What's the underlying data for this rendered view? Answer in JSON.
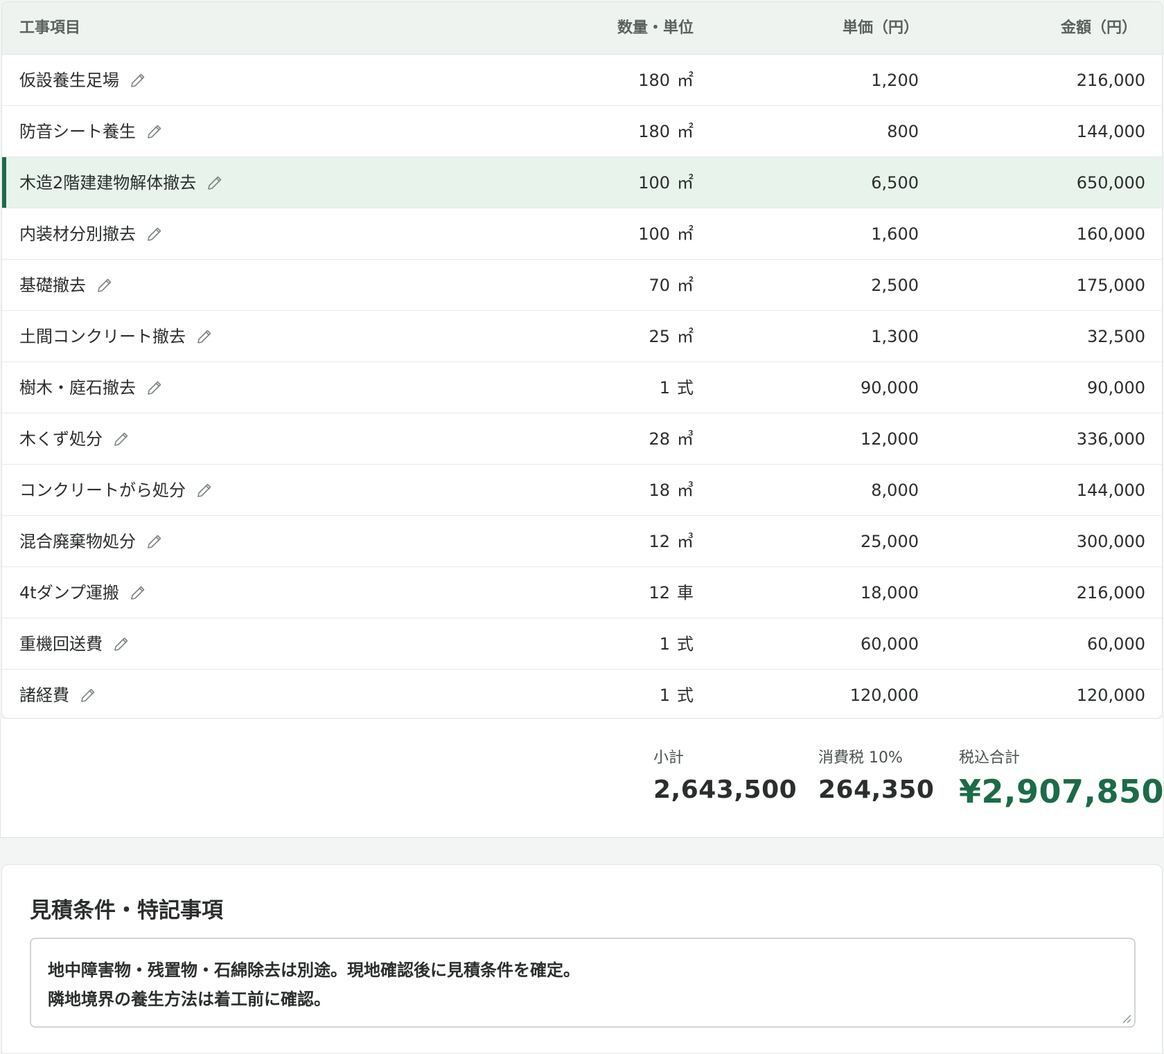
{
  "table": {
    "headers": {
      "item": "工事項目",
      "qty": "数量・単位",
      "unit_price": "単価（円）",
      "amount": "金額（円）"
    },
    "rows": [
      {
        "name": "仮設養生足場",
        "qty": "180",
        "unit": "㎡",
        "price": "1,200",
        "amount": "216,000"
      },
      {
        "name": "防音シート養生",
        "qty": "180",
        "unit": "㎡",
        "price": "800",
        "amount": "144,000"
      },
      {
        "name": "木造2階建建物解体撤去",
        "qty": "100",
        "unit": "㎡",
        "price": "6,500",
        "amount": "650,000",
        "selected": true
      },
      {
        "name": "内装材分別撤去",
        "qty": "100",
        "unit": "㎡",
        "price": "1,600",
        "amount": "160,000"
      },
      {
        "name": "基礎撤去",
        "qty": "70",
        "unit": "㎡",
        "price": "2,500",
        "amount": "175,000"
      },
      {
        "name": "土間コンクリート撤去",
        "qty": "25",
        "unit": "㎡",
        "price": "1,300",
        "amount": "32,500"
      },
      {
        "name": "樹木・庭石撤去",
        "qty": "1",
        "unit": "式",
        "price": "90,000",
        "amount": "90,000"
      },
      {
        "name": "木くず処分",
        "qty": "28",
        "unit": "㎥",
        "price": "12,000",
        "amount": "336,000"
      },
      {
        "name": "コンクリートがら処分",
        "qty": "18",
        "unit": "㎥",
        "price": "8,000",
        "amount": "144,000"
      },
      {
        "name": "混合廃棄物処分",
        "qty": "12",
        "unit": "㎥",
        "price": "25,000",
        "amount": "300,000"
      },
      {
        "name": "4tダンプ運搬",
        "qty": "12",
        "unit": "車",
        "price": "18,000",
        "amount": "216,000"
      },
      {
        "name": "重機回送費",
        "qty": "1",
        "unit": "式",
        "price": "60,000",
        "amount": "60,000"
      },
      {
        "name": "諸経費",
        "qty": "1",
        "unit": "式",
        "price": "120,000",
        "amount": "120,000"
      }
    ]
  },
  "totals": {
    "subtotal_label": "小計",
    "subtotal_value": "2,643,500",
    "tax_label": "消費税 10%",
    "tax_value": "264,350",
    "grand_label": "税込合計",
    "grand_value": "¥2,907,850"
  },
  "notes": {
    "title": "見積条件・特記事項",
    "lines": [
      "地中障害物・残置物・石綿除去は別途。現地確認後に見積条件を確定。",
      "隣地境界の養生方法は着工前に確認。"
    ]
  },
  "colors": {
    "accent": "#1c6b48",
    "header_bg": "#eef3f0",
    "selected_row_bg": "#e8f3ec",
    "page_bg": "#f2f5f3"
  },
  "icons": {
    "row_action": "pencil-icon"
  }
}
